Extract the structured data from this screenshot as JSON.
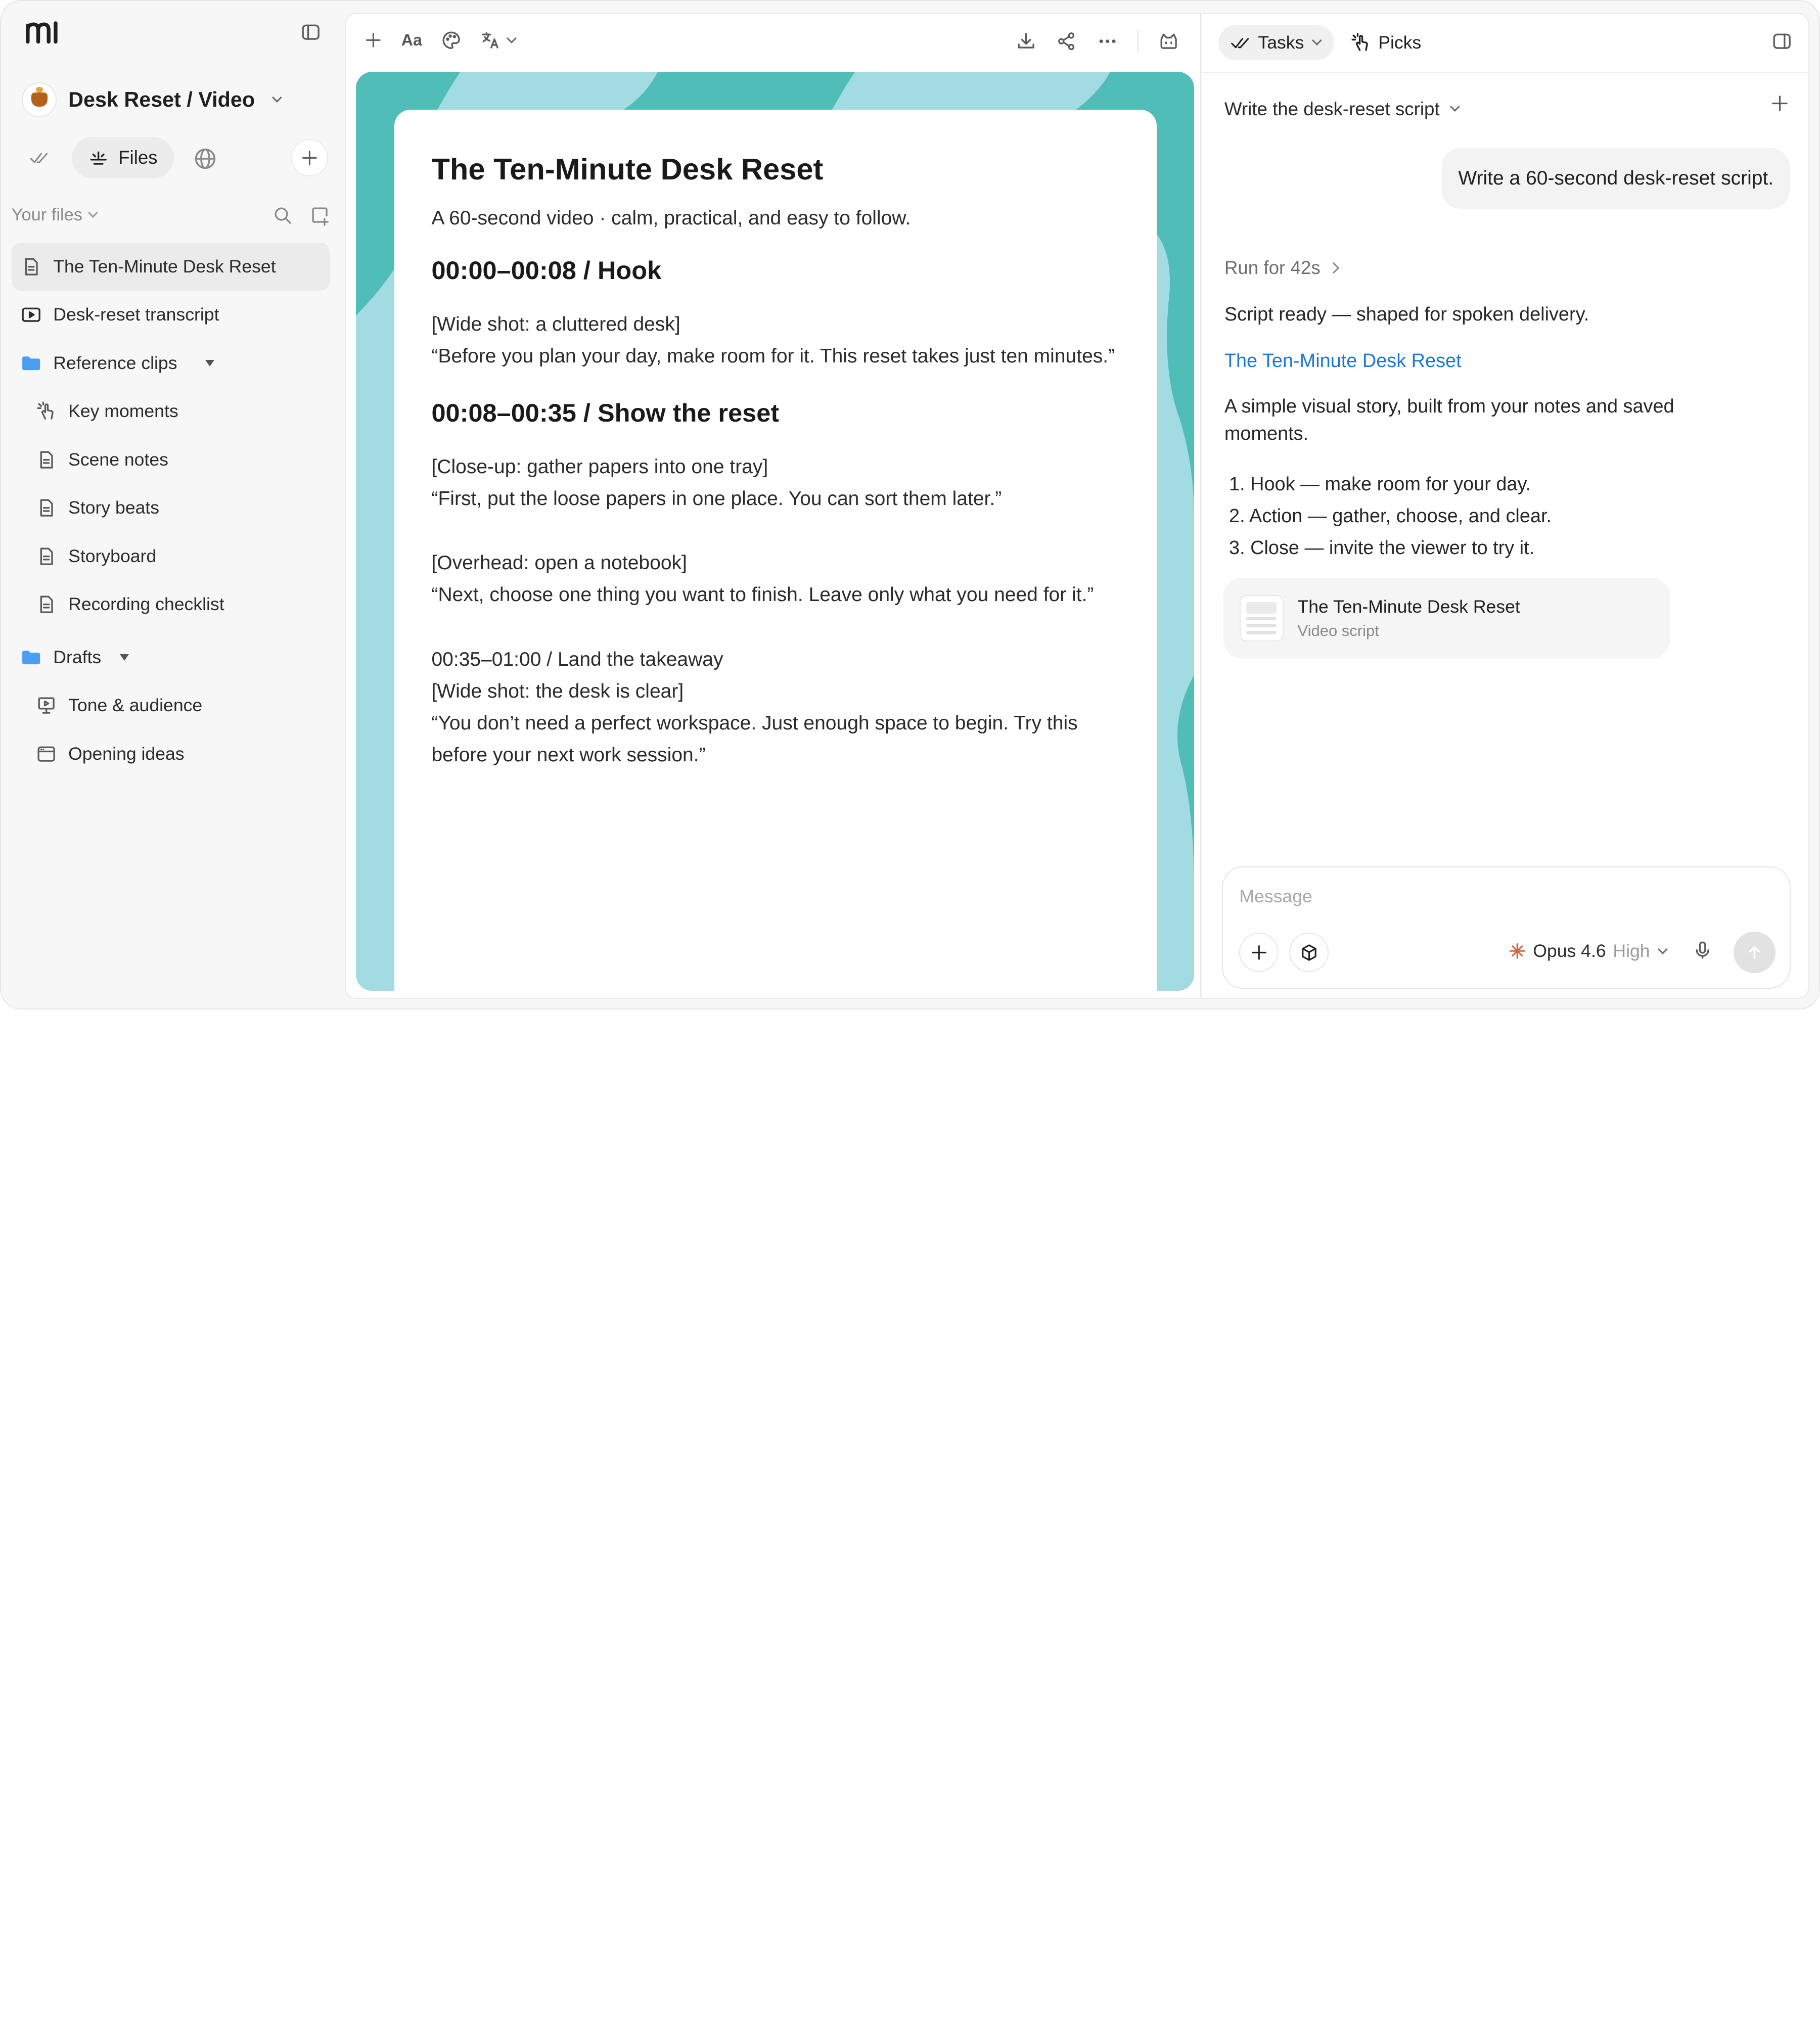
{
  "sidebar": {
    "project_title": "Desk Reset / Video",
    "tabs": {
      "files_label": "Files"
    },
    "section_label": "Your files",
    "items": [
      {
        "label": "The Ten-Minute Desk Reset",
        "icon": "document-icon"
      },
      {
        "label": "Desk-reset transcript",
        "icon": "video-icon"
      },
      {
        "label": "Reference clips",
        "icon": "folder-icon"
      },
      {
        "label": "Key moments",
        "icon": "pointer-icon"
      },
      {
        "label": "Scene notes",
        "icon": "document-icon"
      },
      {
        "label": "Story beats",
        "icon": "document-icon"
      },
      {
        "label": "Storyboard",
        "icon": "document-icon"
      },
      {
        "label": "Recording checklist",
        "icon": "document-icon"
      },
      {
        "label": "Drafts",
        "icon": "folder-icon"
      },
      {
        "label": "Tone & audience",
        "icon": "presentation-icon"
      },
      {
        "label": "Opening ideas",
        "icon": "browser-icon"
      }
    ]
  },
  "editor": {
    "toolbar": {
      "font_label": "Aa"
    },
    "doc": {
      "title": "The Ten-Minute Desk Reset",
      "subtitle": "A 60-second video · calm, practical, and easy to follow.",
      "section1_heading": "00:00–00:08  /  Hook",
      "section1_cue": "[Wide shot: a cluttered desk]",
      "section1_line": "“Before you plan your day, make room for it. This reset takes just ten minutes.”",
      "section2_heading": "00:08–00:35  /  Show the reset",
      "section2_cue1": "[Close-up: gather papers into one tray]",
      "section2_line1": "“First, put the loose papers in one place. You can sort them later.”",
      "section2_cue2": "[Overhead: open a notebook]",
      "section2_line2": "“Next, choose one thing you want to finish. Leave only what you need for it.”",
      "section3_heading": "00:35–01:00  /  Land the takeaway",
      "section3_cue": "[Wide shot: the desk is clear]",
      "section3_line": "“You don’t need a perfect workspace. Just enough space to begin. Try this before your next work session.”"
    },
    "canvas_color": "#51bdb8",
    "canvas_accent": "#a3dbe2"
  },
  "right_panel": {
    "tabs": {
      "tasks_label": "Tasks",
      "picks_label": "Picks"
    },
    "thread_title": "Write the desk-reset script",
    "user_message": "Write a 60-second desk-reset script.",
    "run_label": "Run for 42s",
    "response_intro": "Script ready — shaped for spoken delivery.",
    "response_link": "The Ten-Minute Desk Reset",
    "response_body": "A simple visual story, built from your notes and saved moments.",
    "steps": [
      "1. Hook — make room for your day.",
      "2. Action — gather, choose, and clear.",
      "3. Close — invite the viewer to try it."
    ],
    "card": {
      "title": "The Ten-Minute Desk Reset",
      "subtitle": "Video script"
    },
    "composer": {
      "placeholder": "Message",
      "model_name": "Opus 4.6",
      "model_effort": "High"
    },
    "link_color": "#1a78d4"
  }
}
